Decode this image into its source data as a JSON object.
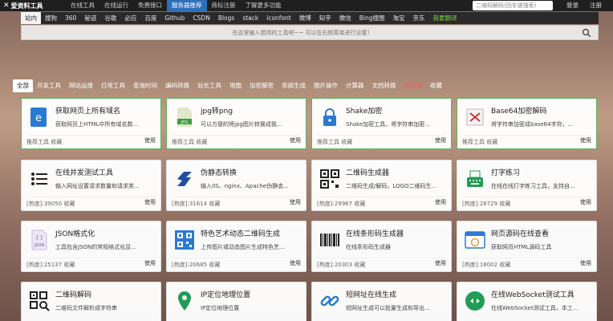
{
  "topbar": {
    "logo": "爱资料工具",
    "nav": [
      {
        "label": "在线工具",
        "active": false
      },
      {
        "label": "在线运行",
        "active": false
      },
      {
        "label": "免费接口",
        "active": false
      },
      {
        "label": "服务器推荐",
        "active": true
      },
      {
        "label": "商标注册",
        "active": false
      },
      {
        "label": "了解更多功能",
        "active": false
      }
    ],
    "search_placeholder": "二维码解码(回车键搜索)",
    "login": "登录",
    "register": "注册"
  },
  "engines": [
    {
      "label": "站内",
      "active": true
    },
    {
      "label": "搜狗"
    },
    {
      "label": "360"
    },
    {
      "label": "秘迹"
    },
    {
      "label": "谷歌"
    },
    {
      "label": "必应"
    },
    {
      "label": "百度"
    },
    {
      "label": "Github"
    },
    {
      "label": "CSDN"
    },
    {
      "label": "Blogs"
    },
    {
      "label": "stack"
    },
    {
      "label": "iconfont"
    },
    {
      "label": "微博"
    },
    {
      "label": "知乎"
    },
    {
      "label": "微信"
    },
    {
      "label": "Bing搜图"
    },
    {
      "label": "淘宝"
    },
    {
      "label": "京东"
    },
    {
      "label": "我要翻译",
      "green": true
    }
  ],
  "main_search": {
    "placeholder": "在这里输入想用的工具吧~~ 可以在右侧菜单进行设置！"
  },
  "tabs": [
    {
      "label": "全部",
      "active": true
    },
    {
      "label": "开发工具"
    },
    {
      "label": "网站运维"
    },
    {
      "label": "日常工具"
    },
    {
      "label": "查询时间"
    },
    {
      "label": "编码转换"
    },
    {
      "label": "站长工具"
    },
    {
      "label": "地图"
    },
    {
      "label": "加密解密"
    },
    {
      "label": "恶搞生成"
    },
    {
      "label": "图片操作"
    },
    {
      "label": "计算器"
    },
    {
      "label": "文档转换"
    },
    {
      "label": "排行榜",
      "hot": true
    },
    {
      "label": "收藏"
    }
  ],
  "cards": [
    {
      "title": "获取网页上所有域名",
      "desc": "获取网页上HTML中所有域名数...",
      "meta": "推荐工具 收藏",
      "use": "使用",
      "icon": "ie-icon",
      "featured": true
    },
    {
      "title": "jpg转png",
      "desc": "可以方便的将jpg图片转换成我...",
      "meta": "推荐工具 收藏",
      "use": "使用",
      "icon": "jpg-file-icon",
      "featured": true
    },
    {
      "title": "Shake加密",
      "desc": "Shake加密工具，将字符串加密...",
      "meta": "推荐工具 收藏",
      "use": "使用",
      "icon": "lock-icon",
      "featured": true
    },
    {
      "title": "Base64加密解码",
      "desc": "将字符串加密成base64字符，...",
      "meta": "推荐工具 收藏",
      "use": "使用",
      "icon": "base64-icon",
      "featured": true
    },
    {
      "title": "在线并发测试工具",
      "desc": "输入网址设置请求数量和请求类...",
      "meta": "[热度]:39050 收藏",
      "use": "使用",
      "icon": "list-icon"
    },
    {
      "title": "伪静态转换",
      "desc": "输入IIS、nginx、Apache伪静态...",
      "meta": "[热度]:31614 收藏",
      "use": "使用",
      "icon": "rewrite-icon"
    },
    {
      "title": "二维码生成器",
      "desc": "二维码生成/解码，LOGO二维码生...",
      "meta": "[热度]:29967 收藏",
      "use": "使用",
      "icon": "qrcode-icon"
    },
    {
      "title": "打字练习",
      "desc": "在线在线打字练习工具，支持自...",
      "meta": "[热度]:28729 收藏",
      "use": "使用",
      "icon": "typewriter-icon"
    },
    {
      "title": "JSON格式化",
      "desc": "工具包含JSON的常规格式化显...",
      "meta": "[热度]:25137 收藏",
      "use": "使用",
      "icon": "json-file-icon"
    },
    {
      "title": "特色艺术动态二维码生成",
      "desc": "上传图片或动态图片生成特色艺...",
      "meta": "[热度]:20685 收藏",
      "use": "使用",
      "icon": "art-qrcode-icon"
    },
    {
      "title": "在线条形码生成器",
      "desc": "在线条形码生成器",
      "meta": "[热度]:20303 收藏",
      "use": "使用",
      "icon": "barcode-icon"
    },
    {
      "title": "网页源码在线查看",
      "desc": "获取网页HTML源码工具",
      "meta": "[热度]:18002 收藏",
      "use": "使用",
      "icon": "browser-icon"
    },
    {
      "title": "二维码解码",
      "desc": "二维码文件解析成字符串",
      "meta": "",
      "use": "",
      "icon": "qrcode-scan-icon"
    },
    {
      "title": "IP定位地理位置",
      "desc": "IP定位地理位置",
      "meta": "",
      "use": "",
      "icon": "map-pin-icon"
    },
    {
      "title": "短网址在线生成",
      "desc": "短网址生成可以批量生成和导出...",
      "meta": "",
      "use": "",
      "icon": "link-icon"
    },
    {
      "title": "在线WebSocket测试工具",
      "desc": "在线WebSocket测试工具，本工...",
      "meta": "",
      "use": "",
      "icon": "websocket-icon"
    }
  ],
  "colors": {
    "accent_blue": "#2d6fb8",
    "featured_border": "#5db35d",
    "hot_red": "#ff5a5a",
    "icon_blue": "#2a7ad4",
    "icon_green": "#1f9d55"
  }
}
